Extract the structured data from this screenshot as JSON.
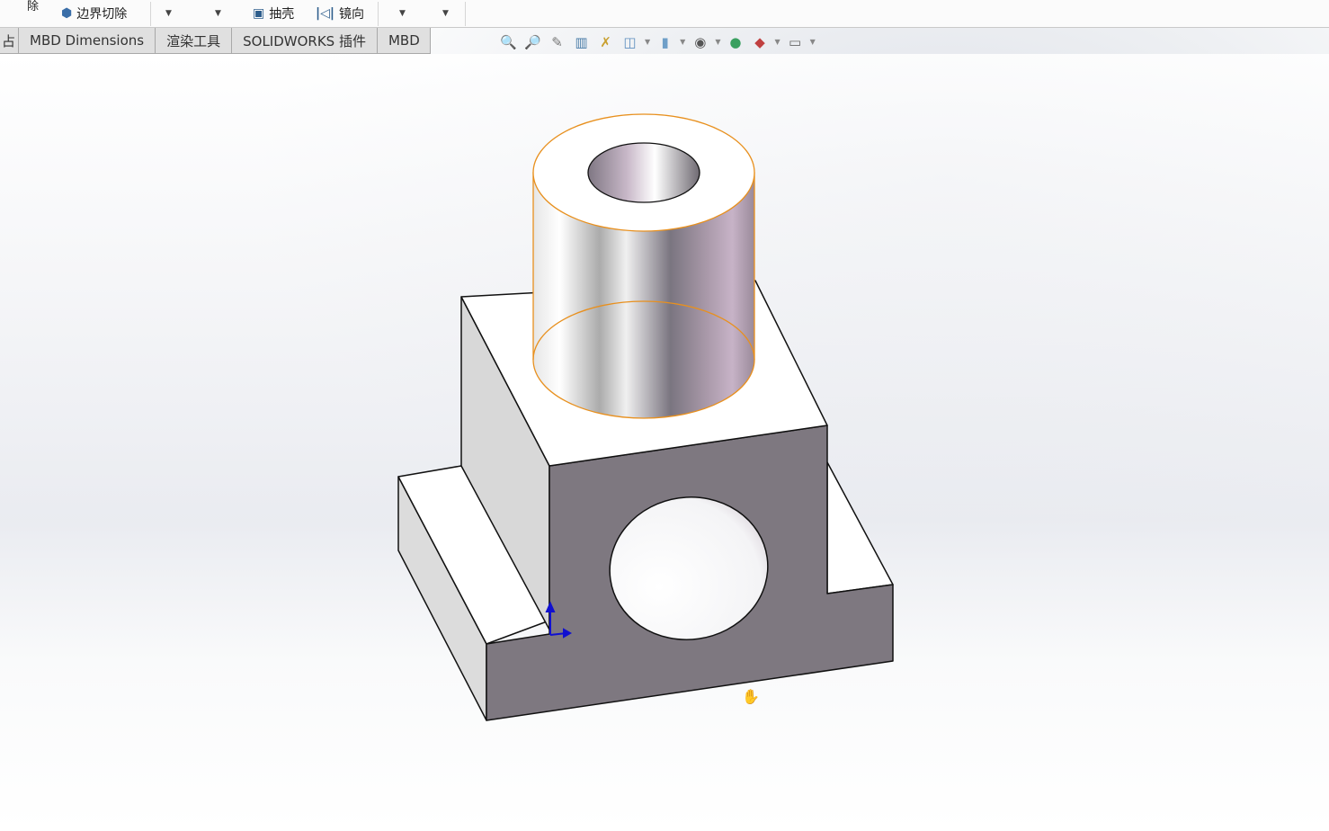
{
  "commands": {
    "partial_label": "除",
    "boundary_cut": "边界切除",
    "shell": "抽壳",
    "mirror": "镜向"
  },
  "tabs": [
    "占",
    "MBD Dimensions",
    "渲染工具",
    "SOLIDWORKS 插件",
    "MBD"
  ],
  "heads_up_toolbar": [
    "zoom-to-fit-icon",
    "zoom-to-area-icon",
    "previous-view-icon",
    "section-view-icon",
    "dynamic-annotation-icon",
    "view-orientation-icon",
    "display-style-icon",
    "hide-show-items-icon",
    "edit-appearance-icon",
    "apply-scene-icon",
    "view-settings-icon"
  ],
  "colors": {
    "selection_edge": "#e8901e",
    "front_face": "#7e7880",
    "side_face": "#d9d9d9",
    "triad_blue": "#1010d0"
  }
}
